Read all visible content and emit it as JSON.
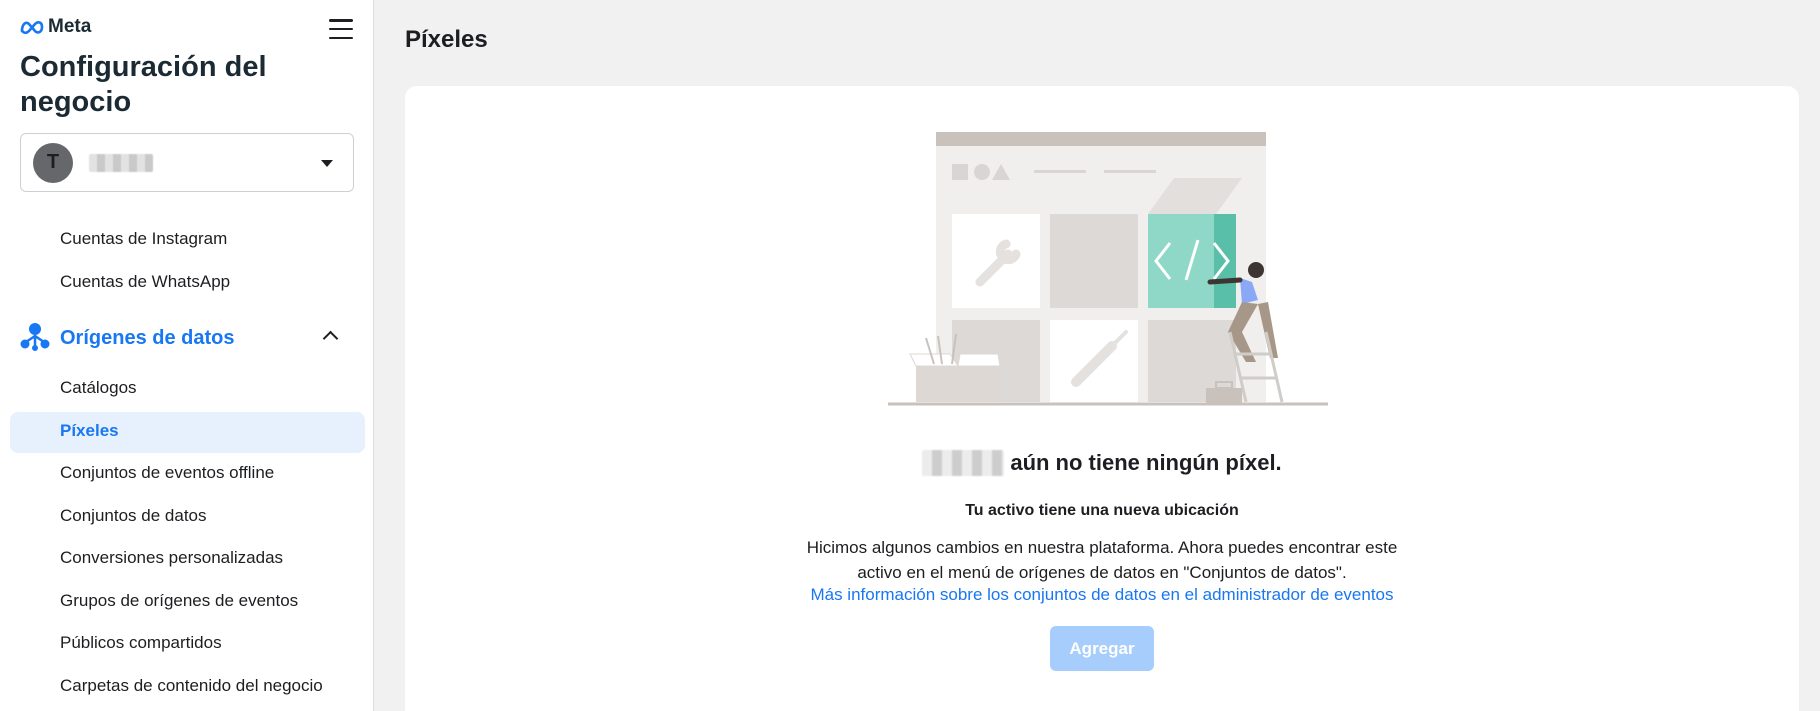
{
  "brand": {
    "name": "Meta",
    "accent": "#1877f2"
  },
  "sidebar": {
    "title": "Configuración del negocio",
    "account": {
      "initial": "T"
    },
    "items_top": [
      {
        "label": "Cuentas de Instagram"
      },
      {
        "label": "Cuentas de WhatsApp"
      }
    ],
    "section": {
      "label": "Orígenes de datos",
      "icon": "data-sources-icon",
      "expanded": true
    },
    "items": [
      {
        "label": "Catálogos"
      },
      {
        "label": "Píxeles",
        "active": true
      },
      {
        "label": "Conjuntos de eventos offline"
      },
      {
        "label": "Conjuntos de datos"
      },
      {
        "label": "Conversiones personalizadas"
      },
      {
        "label": "Grupos de orígenes de eventos"
      },
      {
        "label": "Públicos compartidos"
      },
      {
        "label": "Carpetas de contenido del negocio"
      }
    ]
  },
  "main": {
    "page_title": "Píxeles",
    "empty_state": {
      "heading_suffix": "aún no tiene ningún píxel.",
      "sub_heading": "Tu activo tiene una nueva ubicación",
      "desc_line1": "Hicimos algunos cambios en nuestra plataforma. Ahora puedes encontrar este",
      "desc_line2": "activo en el menú de orígenes de datos en \"Conjuntos de datos\".",
      "link": "Más información sobre los conjuntos de datos en el administrador de eventos",
      "button": "Agregar"
    }
  }
}
